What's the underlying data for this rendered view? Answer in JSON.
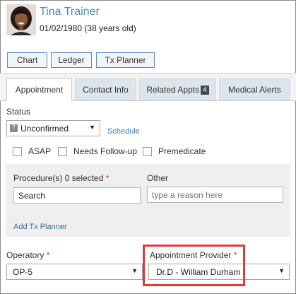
{
  "patient": {
    "name": "Tina Trainer",
    "dob_age": "01/02/1980 (38 years old)"
  },
  "toolbar": {
    "chart": "Chart",
    "ledger": "Ledger",
    "tx_planner": "Tx Planner"
  },
  "tabs": {
    "appointment": "Appointment",
    "contact_info": "Contact Info",
    "related_appts": "Related Appts",
    "related_appts_count": "4",
    "medical_alerts": "Medical Alerts"
  },
  "status": {
    "label": "Status",
    "icon_glyph": "?",
    "value": "Unconfirmed",
    "schedule_link": "Schedule"
  },
  "checkboxes": {
    "asap": "ASAP",
    "needs_followup": "Needs Follow-up",
    "premedicate": "Premedicate"
  },
  "procedures": {
    "label": "Procedure(s)",
    "selected_count": "0 selected",
    "required_mark": "*",
    "search_value": "Search",
    "other_label": "Other",
    "other_placeholder": "type a reason here",
    "add_tx_planner": "Add Tx Planner"
  },
  "operatory": {
    "label": "Operatory",
    "required_mark": "*",
    "value": "OP-5"
  },
  "provider": {
    "label": "Appointment Provider",
    "required_mark": "*",
    "value": "Dr.D - William Durham"
  },
  "colors": {
    "accent_link": "#3b7cc0",
    "patient_name": "#4a86c5",
    "highlight": "#e03a3a",
    "badge_bg": "#3c4a58"
  }
}
